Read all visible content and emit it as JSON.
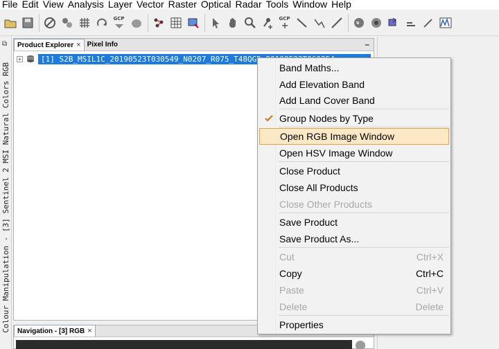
{
  "menubar": {
    "items": [
      "File",
      "Edit",
      "View",
      "Analysis",
      "Layer",
      "Vector",
      "Raster",
      "Optical",
      "Radar",
      "Tools",
      "Window",
      "Help"
    ]
  },
  "toolbar": {
    "icons": [
      "open-product-icon",
      "save-product-icon",
      "no-data-icon",
      "ground-stations-icon",
      "rotate-icon",
      "gcp-icon",
      "world-icon",
      "pins-icon",
      "statistics-icon",
      "select-icon",
      "pan-icon",
      "zoom-icon",
      "pin-placing-icon",
      "gcp-placing-icon",
      "line-drawing-icon",
      "polyline-drawing-icon",
      "range-finder-icon",
      "range-finder-icon",
      "world-map-icon",
      "eye-icon",
      "export-icon",
      "shape-icon",
      "dropper-icon",
      "spectrum-icon"
    ],
    "gcp_label": "GCP"
  },
  "side_strip": {
    "text": "Colour Manipulation - [3] Sentinel 2 MSI Natural Colors RGB"
  },
  "explorer": {
    "tabs": [
      {
        "label": "Product Explorer",
        "close": "×"
      },
      {
        "label": "Pixel Info"
      }
    ],
    "minimize": "–",
    "product": {
      "expander": "+",
      "label": "[1] S2B_MSIL1C_20190523T030549_N0207_R075_T48QGD_20190523T060254"
    }
  },
  "navigation": {
    "tab_label": "Navigation - [3] RGB",
    "close": "×"
  },
  "context_menu": {
    "items": [
      {
        "label": "Band Maths...",
        "enabled": true
      },
      {
        "label": "Add Elevation Band",
        "enabled": true
      },
      {
        "label": "Add Land Cover Band",
        "enabled": true
      },
      {
        "label": "Group Nodes by Type",
        "enabled": true,
        "checked": true
      },
      {
        "label": "Open RGB Image Window",
        "enabled": true,
        "highlighted": true
      },
      {
        "label": "Open HSV Image Window",
        "enabled": true
      },
      {
        "label": "Close Product",
        "enabled": true
      },
      {
        "label": "Close All Products",
        "enabled": true
      },
      {
        "label": "Close Other Products",
        "enabled": false
      },
      {
        "label": "Save Product",
        "enabled": true
      },
      {
        "label": "Save Product As...",
        "enabled": true
      },
      {
        "label": "Cut",
        "enabled": false,
        "shortcut": "Ctrl+X"
      },
      {
        "label": "Copy",
        "enabled": true,
        "shortcut": "Ctrl+C"
      },
      {
        "label": "Paste",
        "enabled": false,
        "shortcut": "Ctrl+V"
      },
      {
        "label": "Delete",
        "enabled": false,
        "shortcut": "Delete"
      },
      {
        "label": "Properties",
        "enabled": true
      }
    ]
  },
  "colors": {
    "selection": "#1c7bdd",
    "menu_highlight": "#fce8c4",
    "menu_highlight_border": "#e2a23f",
    "disabled_text": "#a8a8a8"
  }
}
